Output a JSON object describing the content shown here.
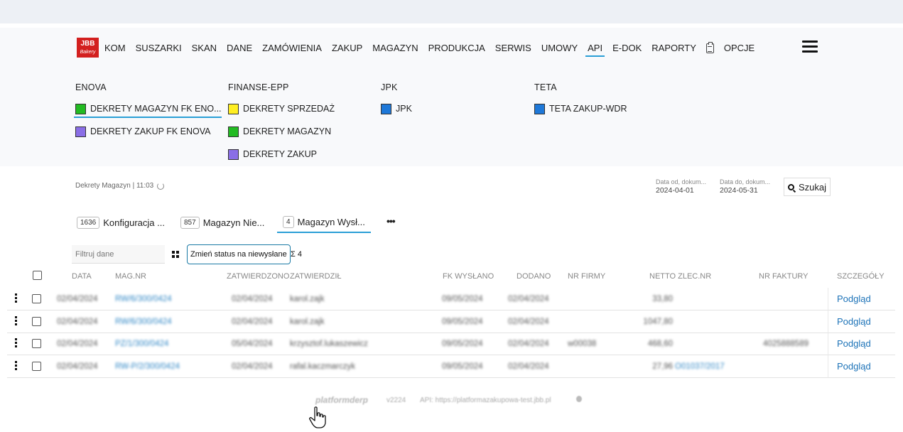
{
  "logo": {
    "text": "JBB"
  },
  "nav": {
    "items": [
      "KOM",
      "SUSZARKI",
      "SKAN",
      "DANE",
      "ZAMÓWIENIA",
      "ZAKUP",
      "MAGAZYN",
      "PRODUKCJA",
      "SERWIS",
      "UMOWY",
      "API",
      "E-DOK",
      "RAPORTY"
    ],
    "after_icon": "OPCJE",
    "active": "API",
    "icons": [
      "clipboard-icon",
      "hamburger-menu-icon"
    ]
  },
  "submenu": {
    "columns": [
      {
        "title": "ENOVA",
        "items": [
          {
            "label": "DEKRETY MAGAZYN FK ENO...",
            "color": "#22bb22"
          },
          {
            "label": "DEKRETY ZAKUP FK ENOVA",
            "color": "#8a6ee6"
          }
        ]
      },
      {
        "title": "FINANSE-EPP",
        "items": [
          {
            "label": "DEKRETY SPRZEDAŻ",
            "color": "#ffee22"
          },
          {
            "label": "DEKRETY MAGAZYN",
            "color": "#22bb22"
          },
          {
            "label": "DEKRETY ZAKUP",
            "color": "#8a6ee6"
          }
        ]
      },
      {
        "title": "JPK",
        "items": [
          {
            "label": "JPK",
            "color": "#1e78d8"
          }
        ]
      },
      {
        "title": "TETA",
        "items": [
          {
            "label": "TETA ZAKUP-WDR",
            "color": "#1e78d8"
          }
        ]
      }
    ]
  },
  "toolbar": {
    "status": "Dekrety Magazyn | 11:03",
    "date_from_label": "Data od, dokum...",
    "date_from_value": "2024-04-01",
    "date_to_label": "Data do, dokum...",
    "date_to_value": "2024-05-31",
    "search_label": "Szukaj"
  },
  "tabs": [
    {
      "count": "1636",
      "label": "Konfiguracja ..."
    },
    {
      "count": "857",
      "label": "Magazyn Nie..."
    },
    {
      "count": "4",
      "label": "Magazyn Wysł..."
    }
  ],
  "tabs_more": "•••",
  "actions": {
    "filter_placeholder": "Filtruj dane",
    "status_button": "Zmień status na niewysłane",
    "sum": "Σ 4"
  },
  "table": {
    "headers": [
      "DATA",
      "MAG.NR",
      "ZATWIERDZONO",
      "ZATWIERDZIŁ",
      "FK WYSŁANO",
      "DODANO",
      "NR FIRMY",
      "NETTO ZLEC.NR",
      "NR FAKTURY",
      "SZCZEGÓŁY"
    ],
    "rows": [
      {
        "data": "02/04/2024",
        "mag_nr": "RW/6/300/0424",
        "zatwierdzono": "02/04/2024",
        "zatwierdzil": "karol.zajk",
        "fk_wyslano": "09/05/2024",
        "dodano": "02/04/2024",
        "nr_firmy": "",
        "netto": "33,80",
        "zlec_nr": "",
        "nr_faktury": "",
        "detail": "Podgląd"
      },
      {
        "data": "02/04/2024",
        "mag_nr": "RW/6/300/0424",
        "zatwierdzono": "02/04/2024",
        "zatwierdzil": "karol.zajk",
        "fk_wyslano": "09/05/2024",
        "dodano": "02/04/2024",
        "nr_firmy": "",
        "netto": "1047,80",
        "zlec_nr": "",
        "nr_faktury": "",
        "detail": "Podgląd"
      },
      {
        "data": "02/04/2024",
        "mag_nr": "PZ/1/300/0424",
        "zatwierdzono": "05/04/2024",
        "zatwierdzil": "krzysztof.lukaszewicz",
        "fk_wyslano": "09/05/2024",
        "dodano": "02/04/2024",
        "nr_firmy": "w00038",
        "netto": "468,60",
        "zlec_nr": "",
        "nr_faktury": "4025888589",
        "detail": "Podgląd"
      },
      {
        "data": "02/04/2024",
        "mag_nr": "RW-P/2/300/0424",
        "zatwierdzono": "02/04/2024",
        "zatwierdzil": "rafal.kaczmarczyk",
        "fk_wyslano": "09/05/2024",
        "dodano": "02/04/2024",
        "nr_firmy": "",
        "netto": "27,96",
        "zlec_nr": "O01037/2017",
        "nr_faktury": "",
        "detail": "Podgląd"
      }
    ]
  },
  "footer": {
    "brand": "platformderp",
    "version": "v2224",
    "api": "API: https://platformazakupowa-test.jbb.pl"
  },
  "colors": {
    "accent": "#2a9fd6",
    "link": "#1d73b8",
    "logo": "#d3201f"
  }
}
